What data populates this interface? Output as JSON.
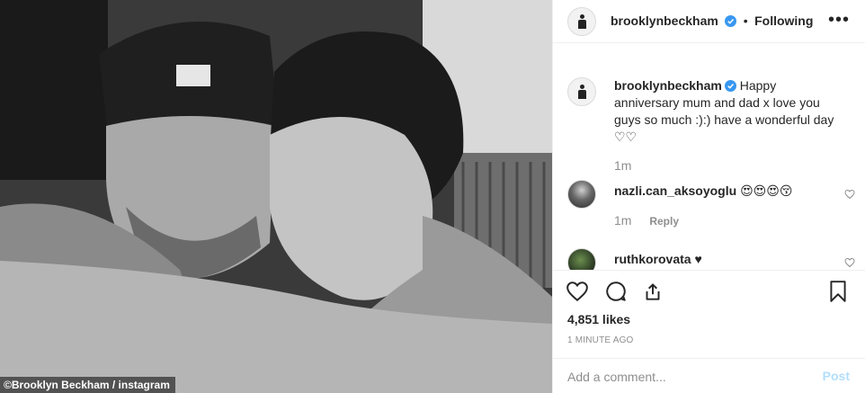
{
  "photo": {
    "credit": "©Brooklyn Beckham / instagram"
  },
  "header": {
    "username": "brooklynbeckham",
    "dot": "•",
    "follow_state": "Following",
    "more_icon": "more-horizontal-icon"
  },
  "caption": {
    "username": "brooklynbeckham",
    "text": "Happy anniversary mum and dad x love you guys so much :):) have a wonderful day ♡♡",
    "time": "1m"
  },
  "comments": [
    {
      "username": "nazli.can_aksoyoglu",
      "text": "😍😍😍😚",
      "time": "1m",
      "reply_label": "Reply"
    },
    {
      "username": "ruthkorovata",
      "text": "♥"
    }
  ],
  "actions": {
    "likes": "4,851 likes",
    "timestamp": "1 MINUTE AGO",
    "icons": [
      "heart-icon",
      "comment-icon",
      "share-icon",
      "bookmark-icon"
    ]
  },
  "add_comment": {
    "placeholder": "Add a comment...",
    "post_label": "Post"
  },
  "colors": {
    "verified": "#3897f0",
    "muted": "#8e8e8e",
    "post_disabled": "#b2dffc"
  }
}
